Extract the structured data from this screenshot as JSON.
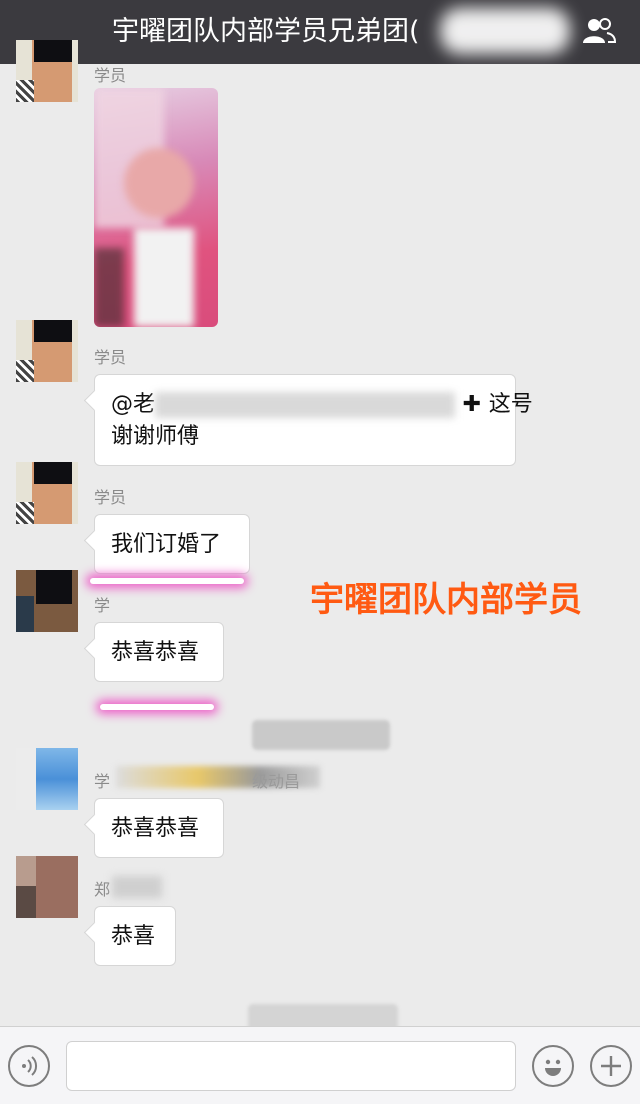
{
  "header": {
    "title": "宇曜团队内部学员兄弟团(",
    "group_icon": "group-members-icon"
  },
  "messages": [
    {
      "sender": "学员",
      "type": "image"
    },
    {
      "sender": "学员",
      "type": "text",
      "text_line1": "@老",
      "text_line1b": "这号",
      "text_line2": "谢谢师傅"
    },
    {
      "sender": "学员",
      "type": "text",
      "text": "我们订婚了"
    },
    {
      "sender": "学",
      "type": "text",
      "text": "恭喜恭喜"
    },
    {
      "sender": "学",
      "sender_tail": "级动昌",
      "type": "text",
      "text": "恭喜恭喜"
    },
    {
      "sender": "郑",
      "type": "text",
      "text": "恭喜"
    }
  ],
  "watermark": "宇曜团队内部学员",
  "composer": {
    "voice_icon": "voice-icon",
    "emoji_icon": "emoji-icon",
    "plus_icon": "plus-icon",
    "input_value": ""
  }
}
